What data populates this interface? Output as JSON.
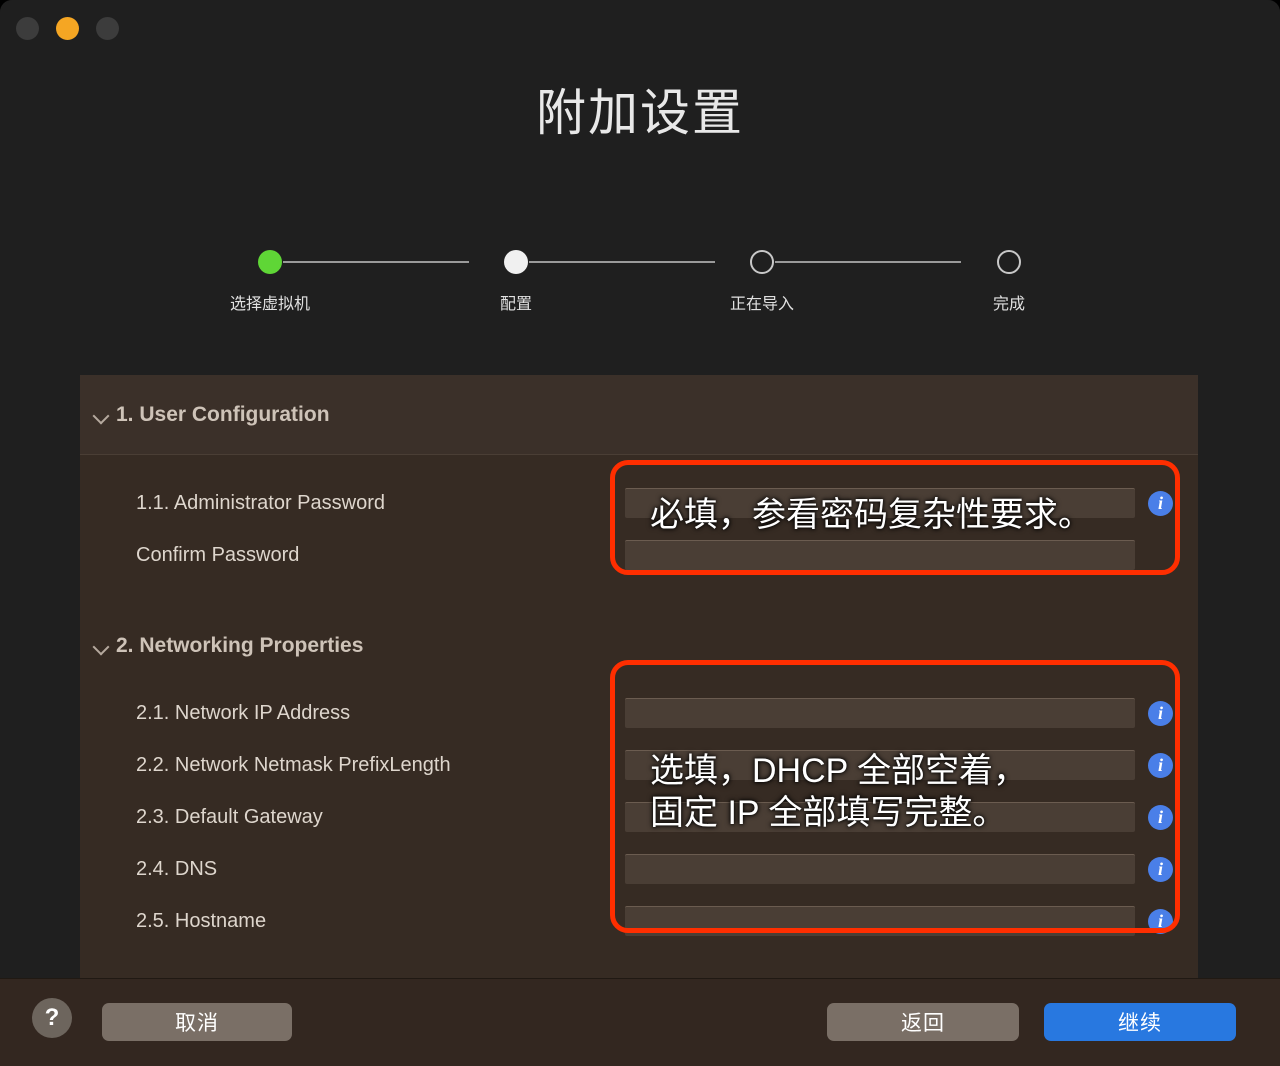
{
  "window": {
    "traffic_lights": [
      {
        "name": "close",
        "color": "#3c3c3c"
      },
      {
        "name": "minimize",
        "color": "#f5a623"
      },
      {
        "name": "zoom",
        "color": "#3c3c3c"
      }
    ]
  },
  "page_title": "附加设置",
  "stepper": {
    "steps": [
      {
        "label": "选择虚拟机",
        "state": "done"
      },
      {
        "label": "配置",
        "state": "current"
      },
      {
        "label": "正在导入",
        "state": "todo"
      },
      {
        "label": "完成",
        "state": "todo"
      }
    ],
    "done_color": "#5fd636",
    "current_color": "#f0f0f0",
    "todo_color": "#c8c8c8"
  },
  "sections": [
    {
      "title": "1. User Configuration",
      "chevron": "chevron-down-icon",
      "rows": [
        {
          "label": "1.1. Administrator Password",
          "value": "",
          "placeholder": "",
          "info": "i"
        },
        {
          "label": "Confirm Password",
          "value": "",
          "placeholder": "",
          "info": "i"
        }
      ]
    },
    {
      "title": "2. Networking Properties",
      "chevron": "chevron-down-icon",
      "rows": [
        {
          "label": "2.1. Network IP Address",
          "value": "",
          "placeholder": "",
          "info": "i"
        },
        {
          "label": "2.2. Network Netmask PrefixLength",
          "value": "",
          "placeholder": "",
          "info": "i"
        },
        {
          "label": "2.3. Default Gateway",
          "value": "",
          "placeholder": "",
          "info": "i"
        },
        {
          "label": "2.4. DNS",
          "value": "",
          "placeholder": "",
          "info": "i"
        },
        {
          "label": "2.5. Hostname",
          "value": "",
          "placeholder": "",
          "info": "i"
        }
      ]
    }
  ],
  "annotations": {
    "color": "#ff2e00",
    "box1_text": "必填，参看密码复杂性要求。",
    "box2_text": "选填，DHCP 全部空着，\n固定 IP 全部填写完整。"
  },
  "footer": {
    "help_label": "?",
    "cancel_label": "取消",
    "back_label": "返回",
    "continue_label": "继续",
    "continue_color": "#2878e0"
  }
}
